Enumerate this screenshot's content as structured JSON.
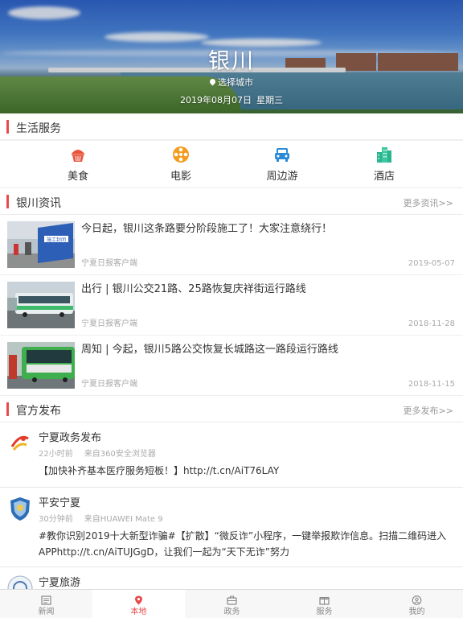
{
  "header": {
    "city": "银川",
    "select_city": "选择城市",
    "date": "2019年08月07日",
    "weekday": "星期三"
  },
  "life_services": {
    "title": "生活服务",
    "items": [
      {
        "label": "美食",
        "icon": "cupcake-icon",
        "color": "#e8553f"
      },
      {
        "label": "电影",
        "icon": "film-reel-icon",
        "color": "#f39c1f"
      },
      {
        "label": "周边游",
        "icon": "car-icon",
        "color": "#2a8ad8"
      },
      {
        "label": "酒店",
        "icon": "building-icon",
        "color": "#2bb58f"
      }
    ]
  },
  "news": {
    "title": "银川资讯",
    "more": "更多资讯>>",
    "items": [
      {
        "title": "今日起，银川这条路要分阶段施工了！大家注意绕行！",
        "source": "宁夏日报客户端",
        "date": "2019-05-07"
      },
      {
        "title": "出行 | 银川公交21路、25路恢复庆祥街运行路线",
        "source": "宁夏日报客户端",
        "date": "2018-11-28"
      },
      {
        "title": "周知 | 今起，银川5路公交恢复长城路这一路段运行路线",
        "source": "宁夏日报客户端",
        "date": "2018-11-15"
      }
    ]
  },
  "official": {
    "title": "官方发布",
    "more": "更多发布>>",
    "posts": [
      {
        "name": "宁夏政务发布",
        "time": "22小时前",
        "from": "来自360安全浏览器",
        "content": "【加快补齐基本医疗服务短板！】http://t.cn/AiT76LAY"
      },
      {
        "name": "平安宁夏",
        "time": "30分钟前",
        "from": "来自HUAWEI Mate 9",
        "content": "#教你识别2019十大新型诈骗#【扩散】“微反诈”小程序，一键举报欺诈信息。扫描二维码进入APPhttp://t.cn/AiTUJGgD，让我们一起为“天下无诈”努力"
      },
      {
        "name": "宁夏旅游",
        "time": "",
        "from": "",
        "content": ""
      }
    ]
  },
  "tabbar": {
    "items": [
      {
        "label": "新闻",
        "icon": "newspaper-icon"
      },
      {
        "label": "本地",
        "icon": "location-pin-icon",
        "active": true
      },
      {
        "label": "政务",
        "icon": "briefcase-icon"
      },
      {
        "label": "服务",
        "icon": "gift-icon"
      },
      {
        "label": "我的",
        "icon": "user-icon"
      }
    ],
    "active_color": "#e84a4a"
  }
}
